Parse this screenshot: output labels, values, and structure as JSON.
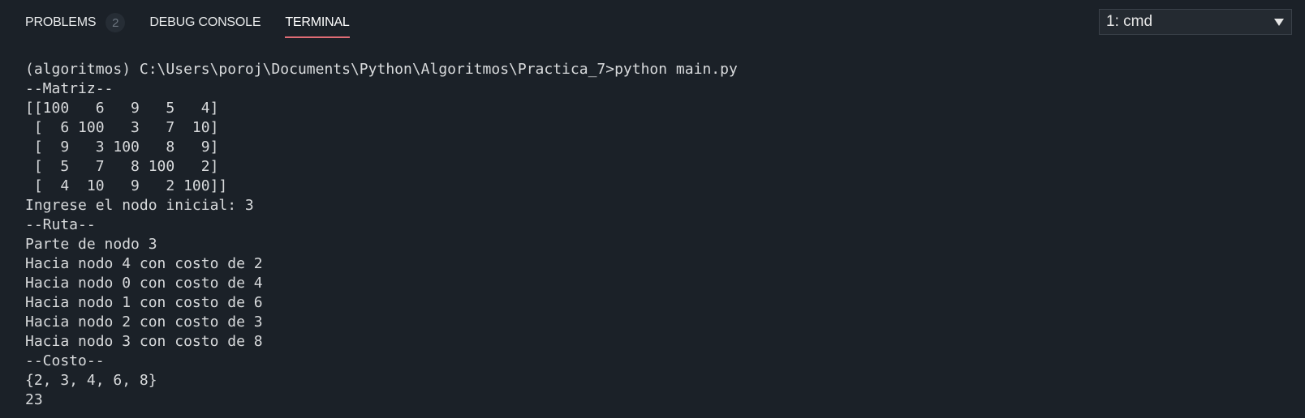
{
  "panel": {
    "tabs": [
      {
        "label": "PROBLEMS",
        "badge": "2"
      },
      {
        "label": "DEBUG CONSOLE"
      },
      {
        "label": "TERMINAL",
        "active": true
      }
    ],
    "terminal_select": {
      "value": "1: cmd"
    }
  },
  "terminal": {
    "lines": [
      "(algoritmos) C:\\Users\\poroj\\Documents\\Python\\Algoritmos\\Practica_7>python main.py",
      "--Matriz--",
      "[[100   6   9   5   4]",
      " [  6 100   3   7  10]",
      " [  9   3 100   8   9]",
      " [  5   7   8 100   2]",
      " [  4  10   9   2 100]]",
      "Ingrese el nodo inicial: 3",
      "--Ruta--",
      "Parte de nodo 3",
      "Hacia nodo 4 con costo de 2",
      "Hacia nodo 0 con costo de 4",
      "Hacia nodo 1 con costo de 6",
      "Hacia nodo 2 con costo de 3",
      "Hacia nodo 3 con costo de 8",
      "--Costo--",
      "{2, 3, 4, 6, 8}",
      "23"
    ]
  },
  "colors": {
    "background": "#1b2128",
    "active_tab_underline": "#e06c75",
    "text": "#d8dadc"
  }
}
